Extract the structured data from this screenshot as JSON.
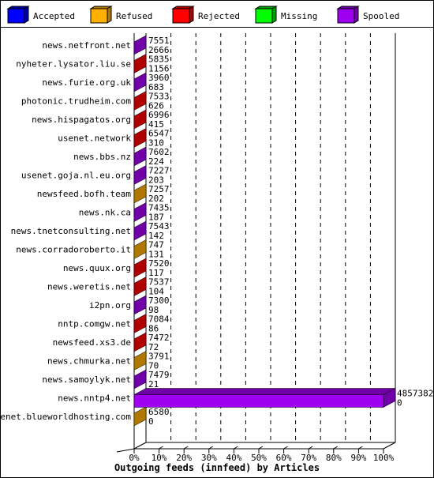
{
  "chart_data": {
    "type": "bar",
    "orientation": "horizontal",
    "stacked": true,
    "three_d": true,
    "title": "Outgoing feeds (innfeed) by Articles",
    "xlabel": "Outgoing feeds (innfeed) by Articles",
    "ylabel": "",
    "xlim": [
      0,
      100
    ],
    "x_unit": "%",
    "x_ticks": [
      "0%",
      "10%",
      "20%",
      "30%",
      "40%",
      "50%",
      "60%",
      "70%",
      "80%",
      "90%",
      "100%"
    ],
    "grid": true,
    "legend_position": "top",
    "legend": [
      {
        "name": "Accepted",
        "color": "#0000ff",
        "shade": "#0000a0"
      },
      {
        "name": "Refused",
        "color": "#ffb000",
        "shade": "#b07800"
      },
      {
        "name": "Rejected",
        "color": "#ff0000",
        "shade": "#b00000"
      },
      {
        "name": "Missing",
        "color": "#00ff00",
        "shade": "#00a000"
      },
      {
        "name": "Spooled",
        "color": "#a000f0",
        "shade": "#7000a8"
      }
    ],
    "categories": [
      "news.netfront.net",
      "nyheter.lysator.liu.se",
      "news.furie.org.uk",
      "photonic.trudheim.com",
      "news.hispagatos.org",
      "usenet.network",
      "news.bbs.nz",
      "usenet.goja.nl.eu.org",
      "newsfeed.bofh.team",
      "news.nk.ca",
      "news.tnetconsulting.net",
      "news.corradoroberto.it",
      "news.quux.org",
      "news.weretis.net",
      "i2pn.org",
      "nntp.comgw.net",
      "newsfeed.xs3.de",
      "news.chmurka.net",
      "news.samoylyk.net",
      "news.nntp4.net",
      "usenet.blueworldhosting.com"
    ],
    "rows": [
      {
        "host": "news.netfront.net",
        "top_value": "7551",
        "bottom_value": "2666",
        "series": "Spooled",
        "percent": 0.05
      },
      {
        "host": "nyheter.lysator.liu.se",
        "top_value": "5835",
        "bottom_value": "1156",
        "series": "Rejected",
        "percent": 0.02
      },
      {
        "host": "news.furie.org.uk",
        "top_value": "3960",
        "bottom_value": "683",
        "series": "Spooled",
        "percent": 0.01
      },
      {
        "host": "photonic.trudheim.com",
        "top_value": "7533",
        "bottom_value": "626",
        "series": "Rejected",
        "percent": 0.01
      },
      {
        "host": "news.hispagatos.org",
        "top_value": "6996",
        "bottom_value": "415",
        "series": "Rejected",
        "percent": 0.01
      },
      {
        "host": "usenet.network",
        "top_value": "6547",
        "bottom_value": "310",
        "series": "Rejected",
        "percent": 0.01
      },
      {
        "host": "news.bbs.nz",
        "top_value": "7602",
        "bottom_value": "224",
        "series": "Spooled",
        "percent": 0.0
      },
      {
        "host": "usenet.goja.nl.eu.org",
        "top_value": "7227",
        "bottom_value": "203",
        "series": "Spooled",
        "percent": 0.0
      },
      {
        "host": "newsfeed.bofh.team",
        "top_value": "7257",
        "bottom_value": "202",
        "series": "Refused",
        "percent": 0.0
      },
      {
        "host": "news.nk.ca",
        "top_value": "7435",
        "bottom_value": "187",
        "series": "Spooled",
        "percent": 0.0
      },
      {
        "host": "news.tnetconsulting.net",
        "top_value": "7543",
        "bottom_value": "142",
        "series": "Spooled",
        "percent": 0.0
      },
      {
        "host": "news.corradoroberto.it",
        "top_value": "747",
        "bottom_value": "131",
        "series": "Refused",
        "percent": 0.0
      },
      {
        "host": "news.quux.org",
        "top_value": "7520",
        "bottom_value": "117",
        "series": "Rejected",
        "percent": 0.0
      },
      {
        "host": "news.weretis.net",
        "top_value": "7537",
        "bottom_value": "104",
        "series": "Rejected",
        "percent": 0.0
      },
      {
        "host": "i2pn.org",
        "top_value": "7300",
        "bottom_value": "98",
        "series": "Spooled",
        "percent": 0.0
      },
      {
        "host": "nntp.comgw.net",
        "top_value": "7084",
        "bottom_value": "86",
        "series": "Rejected",
        "percent": 0.0
      },
      {
        "host": "newsfeed.xs3.de",
        "top_value": "7472",
        "bottom_value": "72",
        "series": "Rejected",
        "percent": 0.0
      },
      {
        "host": "news.chmurka.net",
        "top_value": "3791",
        "bottom_value": "70",
        "series": "Refused",
        "percent": 0.0
      },
      {
        "host": "news.samoylyk.net",
        "top_value": "7479",
        "bottom_value": "21",
        "series": "Spooled",
        "percent": 0.0
      },
      {
        "host": "news.nntp4.net",
        "top_value": "4857382",
        "bottom_value": "0",
        "series": "Spooled",
        "percent": 100
      },
      {
        "host": "usenet.blueworldhosting.com",
        "top_value": "6580",
        "bottom_value": "0",
        "series": "Refused",
        "percent": 0.0
      }
    ]
  }
}
